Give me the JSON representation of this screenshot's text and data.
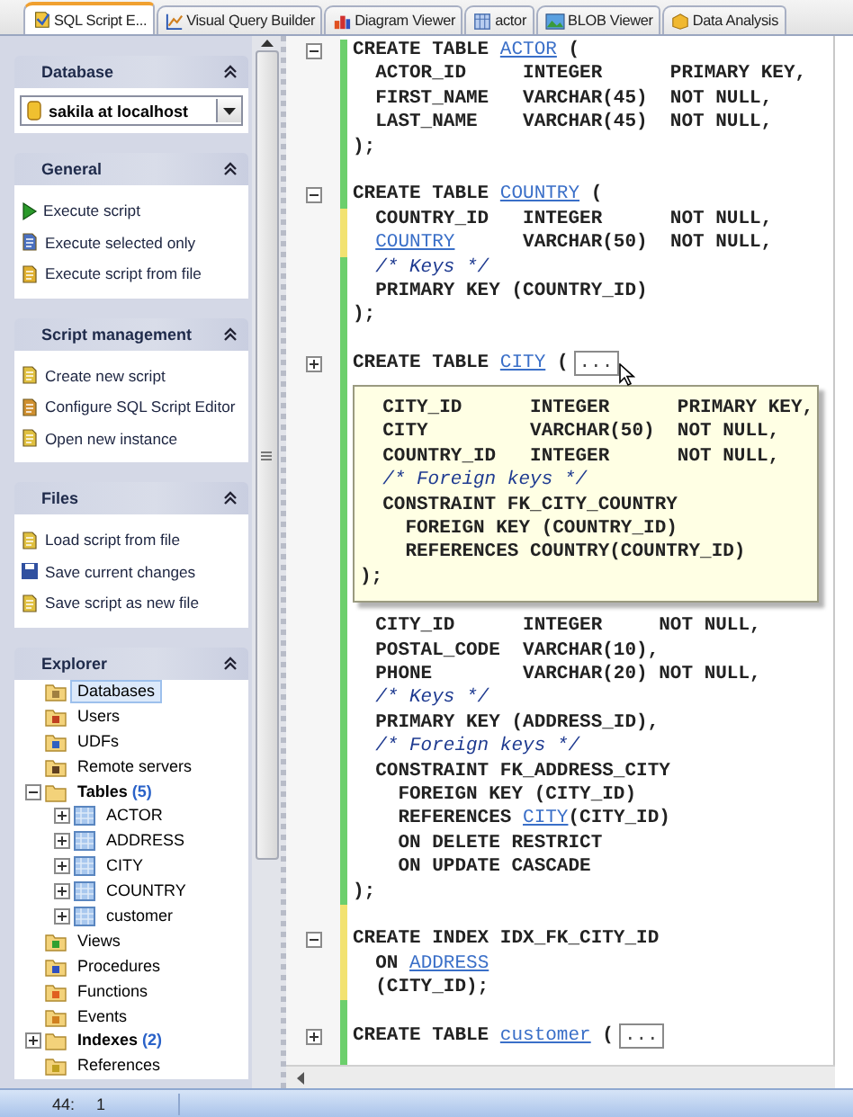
{
  "tabs": [
    {
      "label": "SQL Script E...",
      "selected": true
    },
    {
      "label": "Visual Query Builder",
      "selected": false
    },
    {
      "label": "Diagram Viewer",
      "selected": false
    },
    {
      "label": "actor",
      "selected": false
    },
    {
      "label": "BLOB Viewer",
      "selected": false
    },
    {
      "label": "Data Analysis",
      "selected": false
    }
  ],
  "sidebar": {
    "sections": [
      {
        "kind": "database",
        "title": "Database",
        "value": "sakila at localhost"
      },
      {
        "kind": "tasks",
        "title": "General",
        "items": [
          "Execute script",
          "Execute selected only",
          "Execute script from file"
        ]
      },
      {
        "kind": "tasks",
        "title": "Script management",
        "items": [
          "Create new script",
          "Configure SQL Script Editor",
          "Open new instance"
        ]
      },
      {
        "kind": "tasks",
        "title": "Files",
        "items": [
          "Load script from file",
          "Save current changes",
          "Save script as new file"
        ]
      },
      {
        "kind": "tree",
        "title": "Explorer",
        "items": [
          {
            "kind": "folder",
            "label": "Databases",
            "selected": true
          },
          {
            "kind": "folder",
            "label": "Users",
            "selected": false
          },
          {
            "kind": "folder",
            "label": "UDFs",
            "selected": false
          },
          {
            "kind": "folder",
            "label": "Remote servers",
            "selected": false
          },
          {
            "kind": "group",
            "label": "Tables",
            "count": "(5)",
            "selected": false,
            "expanded": true,
            "children": [
              {
                "kind": "table",
                "label": "ACTOR",
                "selected": false,
                "expanded": false
              },
              {
                "kind": "table",
                "label": "ADDRESS",
                "selected": false,
                "expanded": false
              },
              {
                "kind": "table",
                "label": "CITY",
                "selected": false,
                "expanded": false
              },
              {
                "kind": "table",
                "label": "COUNTRY",
                "selected": false,
                "expanded": false
              },
              {
                "kind": "table",
                "label": "customer",
                "selected": false,
                "expanded": false
              }
            ]
          },
          {
            "kind": "folder",
            "label": "Views",
            "selected": false
          },
          {
            "kind": "folder",
            "label": "Procedures",
            "selected": false
          },
          {
            "kind": "folder",
            "label": "Functions",
            "selected": false
          },
          {
            "kind": "folder",
            "label": "Events",
            "selected": false
          },
          {
            "kind": "group",
            "label": "Indexes",
            "count": "(2)",
            "selected": false,
            "expanded": false
          },
          {
            "kind": "folder",
            "label": "References",
            "selected": false
          }
        ]
      }
    ]
  },
  "editor": {
    "lines": [
      {
        "kind": "code",
        "modified": false,
        "collapsed": false,
        "segments": [
          {
            "kind": "code",
            "text": "CREATE TABLE "
          },
          {
            "kind": "link",
            "text": "ACTOR"
          },
          {
            "kind": "code",
            "text": " ("
          }
        ]
      },
      {
        "kind": "code",
        "modified": false,
        "segments": [
          {
            "kind": "code",
            "text": "  ACTOR_ID     INTEGER      PRIMARY KEY,"
          }
        ]
      },
      {
        "kind": "code",
        "modified": false,
        "segments": [
          {
            "kind": "code",
            "text": "  FIRST_NAME   VARCHAR(45)  NOT NULL,"
          }
        ]
      },
      {
        "kind": "code",
        "modified": false,
        "segments": [
          {
            "kind": "code",
            "text": "  LAST_NAME    VARCHAR(45)  NOT NULL,"
          }
        ]
      },
      {
        "kind": "code",
        "modified": false,
        "segments": [
          {
            "kind": "code",
            "text": ");"
          }
        ]
      },
      {
        "kind": "blank",
        "modified": false
      },
      {
        "kind": "code",
        "modified": false,
        "collapsed": false,
        "segments": [
          {
            "kind": "code",
            "text": "CREATE TABLE "
          },
          {
            "kind": "link",
            "text": "COUNTRY"
          },
          {
            "kind": "code",
            "text": " ("
          }
        ]
      },
      {
        "kind": "code",
        "modified": true,
        "segments": [
          {
            "kind": "code",
            "text": "  COUNTRY_ID   INTEGER      NOT NULL,"
          }
        ]
      },
      {
        "kind": "code",
        "modified": true,
        "segments": [
          {
            "kind": "link",
            "text": "  COUNTRY"
          },
          {
            "kind": "code",
            "text": "      VARCHAR(50)  NOT NULL,"
          }
        ]
      },
      {
        "kind": "code",
        "modified": false,
        "segments": [
          {
            "kind": "comment",
            "text": "  /* Keys */"
          }
        ]
      },
      {
        "kind": "code",
        "modified": false,
        "segments": [
          {
            "kind": "code",
            "text": "  PRIMARY KEY (COUNTRY_ID)"
          }
        ]
      },
      {
        "kind": "code",
        "modified": false,
        "segments": [
          {
            "kind": "code",
            "text": ");"
          }
        ]
      },
      {
        "kind": "blank",
        "modified": false
      },
      {
        "kind": "code",
        "modified": false,
        "collapsed": true,
        "pointer": true,
        "segments": [
          {
            "kind": "code",
            "text": "CREATE TABLE "
          },
          {
            "kind": "link",
            "text": "CITY"
          },
          {
            "kind": "code",
            "text": " ("
          },
          {
            "kind": "collapsed",
            "text": "..."
          }
        ]
      },
      {
        "kind": "tooltip",
        "modified": false,
        "lines": [
          [
            {
              "kind": "code",
              "text": "  CITY_ID      INTEGER      PRIMARY KEY,"
            }
          ],
          [
            {
              "kind": "code",
              "text": "  CITY         VARCHAR(50)  NOT NULL,"
            }
          ],
          [
            {
              "kind": "code",
              "text": "  COUNTRY_ID   INTEGER      NOT NULL,"
            }
          ],
          [
            {
              "kind": "comment",
              "text": "  /* Foreign keys */"
            }
          ],
          [
            {
              "kind": "code",
              "text": "  CONSTRAINT FK_CITY_COUNTRY"
            }
          ],
          [
            {
              "kind": "code",
              "text": "    FOREIGN KEY (COUNTRY_ID)"
            }
          ],
          [
            {
              "kind": "code",
              "text": "    REFERENCES COUNTRY(COUNTRY_ID)"
            }
          ],
          [
            {
              "kind": "code",
              "text": ");"
            }
          ]
        ]
      },
      {
        "kind": "code",
        "modified": false,
        "segments": [
          {
            "kind": "code",
            "text": "  CITY_ID      INTEGER     NOT NULL,"
          }
        ]
      },
      {
        "kind": "code",
        "modified": false,
        "segments": [
          {
            "kind": "code",
            "text": "  POSTAL_CODE  VARCHAR(10),"
          }
        ]
      },
      {
        "kind": "code",
        "modified": false,
        "segments": [
          {
            "kind": "code",
            "text": "  PHONE        VARCHAR(20) NOT NULL,"
          }
        ]
      },
      {
        "kind": "code",
        "modified": false,
        "segments": [
          {
            "kind": "comment",
            "text": "  /* Keys */"
          }
        ]
      },
      {
        "kind": "code",
        "modified": false,
        "segments": [
          {
            "kind": "code",
            "text": "  PRIMARY KEY (ADDRESS_ID),"
          }
        ]
      },
      {
        "kind": "code",
        "modified": false,
        "segments": [
          {
            "kind": "comment",
            "text": "  /* Foreign keys */"
          }
        ]
      },
      {
        "kind": "code",
        "modified": false,
        "segments": [
          {
            "kind": "code",
            "text": "  CONSTRAINT FK_ADDRESS_CITY"
          }
        ]
      },
      {
        "kind": "code",
        "modified": false,
        "segments": [
          {
            "kind": "code",
            "text": "    FOREIGN KEY (CITY_ID)"
          }
        ]
      },
      {
        "kind": "code",
        "modified": false,
        "segments": [
          {
            "kind": "code",
            "text": "    REFERENCES "
          },
          {
            "kind": "link",
            "text": "CITY"
          },
          {
            "kind": "code",
            "text": "(CITY_ID)"
          }
        ]
      },
      {
        "kind": "code",
        "modified": false,
        "segments": [
          {
            "kind": "code",
            "text": "    ON DELETE RESTRICT"
          }
        ]
      },
      {
        "kind": "code",
        "modified": false,
        "segments": [
          {
            "kind": "code",
            "text": "    ON UPDATE CASCADE"
          }
        ]
      },
      {
        "kind": "code",
        "modified": false,
        "segments": [
          {
            "kind": "code",
            "text": ");"
          }
        ]
      },
      {
        "kind": "blank",
        "modified": true
      },
      {
        "kind": "code",
        "modified": true,
        "collapsed": false,
        "segments": [
          {
            "kind": "code",
            "text": "CREATE INDEX IDX_FK_CITY_ID"
          }
        ]
      },
      {
        "kind": "code",
        "modified": true,
        "segments": [
          {
            "kind": "code",
            "text": "  ON "
          },
          {
            "kind": "link",
            "text": "ADDRESS"
          }
        ]
      },
      {
        "kind": "code",
        "modified": true,
        "segments": [
          {
            "kind": "code",
            "text": "  (CITY_ID);"
          }
        ]
      },
      {
        "kind": "blank",
        "modified": false
      },
      {
        "kind": "code",
        "modified": false,
        "collapsed": true,
        "segments": [
          {
            "kind": "code",
            "text": "CREATE TABLE "
          },
          {
            "kind": "link",
            "text": "customer"
          },
          {
            "kind": "code",
            "text": " ("
          },
          {
            "kind": "collapsed",
            "text": "..."
          }
        ]
      }
    ]
  },
  "status_bar": {
    "line": "44:",
    "column": "1"
  }
}
